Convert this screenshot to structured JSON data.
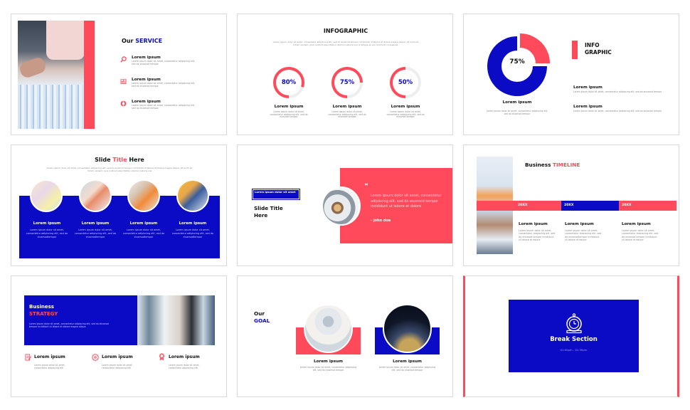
{
  "colors": {
    "accent_red": "#fe4a5a",
    "accent_blue": "#0b0bc5",
    "text": "#111111",
    "muted": "#8a8a8a",
    "ring_track": "#eeeeee"
  },
  "slides": [
    {
      "id": "our-service",
      "title_a": "Our",
      "title_b": "SERVICE",
      "items": [
        {
          "icon": "search-icon",
          "title": "Lorem ipsum",
          "text": "Lorem ipsum dolor sit amet, consectetur adipiscing elit, sed do eiusmod tempor"
        },
        {
          "icon": "newspaper-icon",
          "title": "Lorem ipsum",
          "text": "Lorem ipsum dolor sit amet, consectetur adipiscing elit, sed do eiusmod tempor"
        },
        {
          "icon": "support-icon",
          "title": "Lorem ipsum",
          "text": "Lorem ipsum dolor sit amet, consectetur adipiscing elit, sed do eiusmod tempor"
        }
      ]
    },
    {
      "id": "infographic-rings",
      "title": "INFOGRAPHIC",
      "intro": "Lorem ipsum dolor sit amet, consectetur adipiscing elit, sed do eiusmod tempor incididunt ut labore et dolore magna aliqua. Ut enim ad minim veniam, quis nostrud exercitation ullamco laboris nisi ut aliquip ex ea commodo consequat.",
      "rings": [
        {
          "value": 80,
          "label": "80%",
          "title": "Lorem ipsum",
          "text": "Lorem ipsum dolor sit amet, consectetur adipiscing elit, sed do eiusmod tempor"
        },
        {
          "value": 75,
          "label": "75%",
          "title": "Lorem ipsum",
          "text": "Lorem ipsum dolor sit amet, consectetur adipiscing elit, sed do eiusmod tempor"
        },
        {
          "value": 50,
          "label": "50%",
          "title": "Lorem ipsum",
          "text": "Lorem ipsum dolor sit amet, consectetur adipiscing elit, sed do eiusmod tempor"
        }
      ]
    },
    {
      "id": "infographic-donut",
      "title_line1": "INFO",
      "title_line2": "GRAPHIC",
      "donut_value": 75,
      "donut_label": "75%",
      "caption_title": "Lorem ipsum",
      "caption_text": "Lorem ipsum dolor sit amet, consectetur adipiscing elit, sed do eiusmod tempor",
      "items": [
        {
          "title": "Lorem ipsum",
          "text": "Lorem ipsum dolor sit amet, consectetur adipiscing elit, sed do eiusmod tempor"
        },
        {
          "title": "Lorem ipsum",
          "text": "Lorem ipsum dolor sit amet, consectetur adipiscing elit, sed do eiusmod tempor"
        }
      ]
    },
    {
      "id": "slide-title-four",
      "title_a": "Slide",
      "title_b": "Title",
      "title_c": "Here",
      "intro": "Lorem ipsum dolor sit amet, consectetur adipiscing elit, sed do eiusmod tempor incididunt ut labore et dolore magna aliqua. Ut enim ad minim veniam, quis nostrud exercitation ullamco laboris nisi",
      "columns": [
        {
          "title": "Lorem ipsum",
          "text": "Lorem ipsum dolor sit amet, consectetur adipiscing elit, sed do eiusmodtempor"
        },
        {
          "title": "Lorem ipsum",
          "text": "Lorem ipsum dolor sit amet, consectetur adipiscing elit, sed do eiusmodtempor"
        },
        {
          "title": "Lorem ipsum",
          "text": "Lorem ipsum dolor sit amet, consectetur adipiscing elit, sed do eiusmodtempor"
        },
        {
          "title": "Lorem ipsum",
          "text": "Lorem ipsum dolor sit amet, consectetur adipiscing elit, sed do eiusmodtempor"
        }
      ]
    },
    {
      "id": "quote",
      "tag": "Lorem ipsum dolor sit amet",
      "title": "Slide Title Here",
      "quote_mark": "“",
      "quote": "Lorem ipsum dolor sit amet, consectetur adipiscing elit, sed do eiusmod tempor incididunt ut labore et dolore",
      "author": "- john doe"
    },
    {
      "id": "business-timeline",
      "title_a": "Business",
      "title_b": "TIMELINE",
      "segments": [
        {
          "label": "20XX",
          "color": "#fe4a5a"
        },
        {
          "label": "20XX",
          "color": "#0b0bc5"
        },
        {
          "label": "20XX",
          "color": "#fe4a5a"
        }
      ],
      "items": [
        {
          "title": "Lorem ipsum",
          "text": "Lorem ipsum dolor sit amet, consectetur adipiscing elit, sed do eiusmod tempor incididunt ut labore et dolore"
        },
        {
          "title": "Lorem ipsum",
          "text": "Lorem ipsum dolor sit amet, consectetur adipiscing elit, sed do eiusmodtempor incididunt ut labore et dolore"
        },
        {
          "title": "Lorem ipsum",
          "text": "Lorem ipsum dolor sit amet, consectetur adipiscing elit, sed do eiusmod tempor incididunt ut labore et dolore"
        }
      ]
    },
    {
      "id": "business-strategy",
      "title_a": "Business",
      "title_b": "STRATEGY",
      "intro": "Lorem ipsum dolor sit amet, consectetur adipiscing elit, sed do eiusmod tempor incididunt ut labore et dolore magna aliqua.",
      "items": [
        {
          "icon": "document-edit-icon",
          "title": "Lorem ipsum",
          "text": "Lorem ipsum dolor sit amet, consectetur adipiscing elit"
        },
        {
          "icon": "brain-icon",
          "title": "Lorem ipsum",
          "text": "Lorem ipsum dolor sit amet, consectetur adipiscing elit"
        },
        {
          "icon": "award-icon",
          "title": "Lorem ipsum",
          "text": "Lorem ipsum dolor sit amet, consectetur adipiscing elit"
        }
      ]
    },
    {
      "id": "our-goal",
      "title_a": "Our",
      "title_b": "GOAL",
      "items": [
        {
          "title": "Lorem ipsum",
          "text": "Lorem ipsum dolor sit amet, consectetur adipiscing elit, sed do eiusmod tempor"
        },
        {
          "title": "Lorem ipsum",
          "text": "Lorem ipsum dolor sit amet, consectetur adipiscing elit, sed do eiusmod tempor"
        }
      ]
    },
    {
      "id": "break-section",
      "title": "Break Section",
      "time": "01:00pm - 01:30pm",
      "icon": "stopwatch-icon"
    }
  ]
}
